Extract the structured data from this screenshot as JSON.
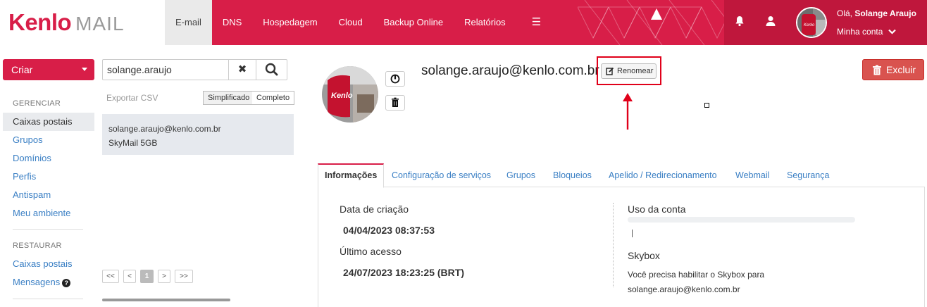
{
  "header": {
    "logo_brand": "Kenlo",
    "logo_product": "MAIL",
    "nav": [
      "E-mail",
      "DNS",
      "Hospedagem",
      "Cloud",
      "Backup Online",
      "Relatórios"
    ],
    "menu_icon": "hamburger-icon",
    "greeting_prefix": "Olá,",
    "user_name": "Solange Araujo",
    "account_label": "Minha conta",
    "colors": {
      "primary": "#d81e48",
      "primary_dark": "#bf173c"
    }
  },
  "sidebar": {
    "create_label": "Criar",
    "manage_heading": "GERENCIAR",
    "manage_items": [
      "Caixas postais",
      "Grupos",
      "Domínios",
      "Perfis",
      "Antispam",
      "Meu ambiente"
    ],
    "restore_heading": "RESTAURAR",
    "restore_items": [
      "Caixas postais",
      "Mensagens"
    ]
  },
  "list": {
    "search_value": "solange.araujo",
    "export_label": "Exportar CSV",
    "view_simple": "Simplificado",
    "view_full": "Completo",
    "item_email": "solange.araujo@kenlo.com.br",
    "item_plan": "SkyMail 5GB",
    "pager": [
      "<<",
      "<",
      "1",
      ">",
      ">>"
    ]
  },
  "detail": {
    "account_email": "solange.araujo@kenlo.com.br",
    "rename_label": "Renomear",
    "delete_label": "Excluir",
    "tabs": [
      "Informações",
      "Configuração de serviços",
      "Grupos",
      "Bloqueios",
      "Apelido / Redirecionamento",
      "Webmail",
      "Segurança"
    ],
    "created_label": "Data de criação",
    "created_value": "04/04/2023 08:37:53",
    "last_access_label": "Último acesso",
    "last_access_value": "24/07/2023 18:23:25 (BRT)",
    "usage_label": "Uso da conta",
    "skybox_label": "Skybox",
    "skybox_line1": "Você precisa habilitar o Skybox para",
    "skybox_line2": "solange.araujo@kenlo.com.br",
    "colors": {
      "delete": "#d9534f",
      "highlight": "#e0001a",
      "link": "#3a7fc4"
    }
  }
}
